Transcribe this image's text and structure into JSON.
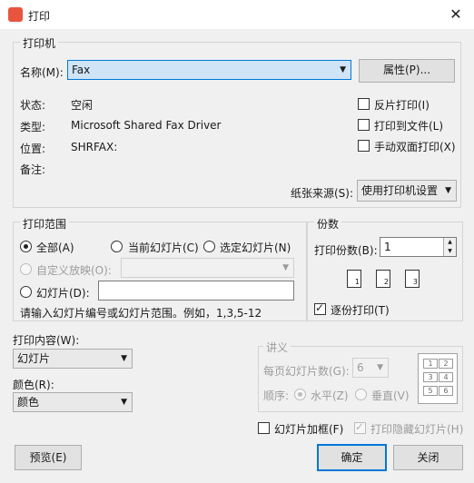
{
  "window": {
    "title": "打印",
    "close_glyph": "✕"
  },
  "printer": {
    "group_title": "打印机",
    "name_label": "名称(M):",
    "name_value": "Fax",
    "properties_button": "属性(P)...",
    "status_label": "状态:",
    "status_value": "空闲",
    "type_label": "类型:",
    "type_value": "Microsoft Shared Fax Driver",
    "location_label": "位置:",
    "location_value": "SHRFAX:",
    "comment_label": "备注:",
    "reverse_print": "反片打印(I)",
    "print_to_file": "打印到文件(L)",
    "manual_duplex": "手动双面打印(X)",
    "paper_source_label": "纸张来源(S):",
    "paper_source_value": "使用打印机设置"
  },
  "range": {
    "group_title": "打印范围",
    "all": "全部(A)",
    "current_slide": "当前幻灯片(C)",
    "selected_slides": "选定幻灯片(N)",
    "custom_show": "自定义放映(O):",
    "slides": "幻灯片(D):",
    "hint": "请输入幻灯片编号或幻灯片范围。例如，1,3,5-12"
  },
  "copies": {
    "group_title": "份数",
    "count_label": "打印份数(B):",
    "count_value": "1",
    "collate": "逐份打印(T)",
    "page_labels": [
      "1",
      "2",
      "3"
    ]
  },
  "content": {
    "label": "打印内容(W):",
    "value": "幻灯片",
    "color_label": "颜色(R):",
    "color_value": "颜色"
  },
  "handouts": {
    "group_title": "讲义",
    "per_page_label": "每页幻灯片数(G):",
    "per_page_value": "6",
    "order_label": "顺序:",
    "horizontal": "水平(Z)",
    "vertical": "垂直(V)",
    "layout_cells": [
      "1",
      "2",
      "3",
      "4",
      "5",
      "6"
    ]
  },
  "options": {
    "frame_slides": "幻灯片加框(F)",
    "print_hidden": "打印隐藏幻灯片(H)"
  },
  "footer": {
    "preview": "预览(E)",
    "ok": "确定",
    "close": "关闭"
  }
}
